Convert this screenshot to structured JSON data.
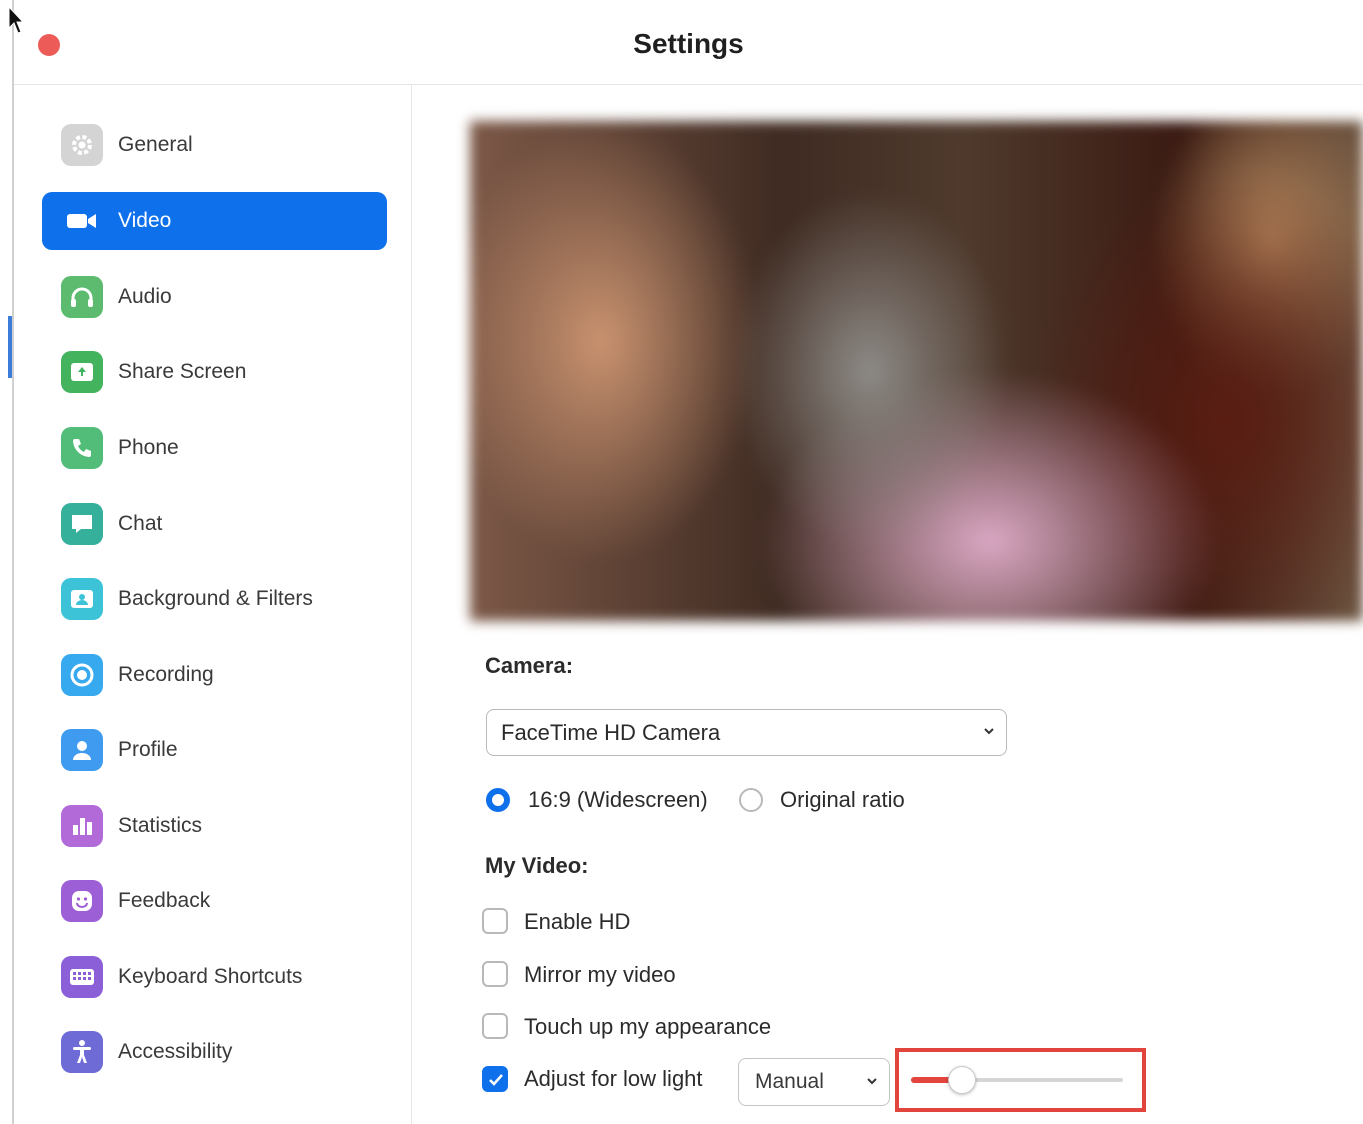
{
  "window": {
    "title": "Settings"
  },
  "sidebar": {
    "items": [
      {
        "label": "General",
        "icon": "gear-icon",
        "color": "#cfcfcf",
        "active": false
      },
      {
        "label": "Video",
        "icon": "video-camera-icon",
        "color": "#0e71eb",
        "active": true
      },
      {
        "label": "Audio",
        "icon": "headphones-icon",
        "color": "#5dbb6f",
        "active": false
      },
      {
        "label": "Share Screen",
        "icon": "share-screen-icon",
        "color": "#43b35e",
        "active": false
      },
      {
        "label": "Phone",
        "icon": "phone-icon",
        "color": "#52bd79",
        "active": false
      },
      {
        "label": "Chat",
        "icon": "chat-bubble-icon",
        "color": "#35b09b",
        "active": false
      },
      {
        "label": "Background & Filters",
        "icon": "background-icon",
        "color": "#3cc3d8",
        "active": false
      },
      {
        "label": "Recording",
        "icon": "record-icon",
        "color": "#36a9ef",
        "active": false
      },
      {
        "label": "Profile",
        "icon": "profile-icon",
        "color": "#3f9bf0",
        "active": false
      },
      {
        "label": "Statistics",
        "icon": "statistics-icon",
        "color": "#b26ad9",
        "active": false
      },
      {
        "label": "Feedback",
        "icon": "feedback-icon",
        "color": "#9d5fd6",
        "active": false
      },
      {
        "label": "Keyboard Shortcuts",
        "icon": "keyboard-icon",
        "color": "#8a5fd8",
        "active": false
      },
      {
        "label": "Accessibility",
        "icon": "accessibility-icon",
        "color": "#6e6bd6",
        "active": false
      }
    ]
  },
  "camera": {
    "label": "Camera:",
    "selected": "FaceTime HD Camera",
    "ratio_options": [
      {
        "label": "16:9 (Widescreen)",
        "selected": true
      },
      {
        "label": "Original ratio",
        "selected": false
      }
    ]
  },
  "my_video": {
    "label": "My Video:",
    "options": [
      {
        "label": "Enable HD",
        "checked": false
      },
      {
        "label": "Mirror my video",
        "checked": false
      },
      {
        "label": "Touch up my appearance",
        "checked": false
      },
      {
        "label": "Adjust for low light",
        "checked": true
      }
    ],
    "low_light_mode": "Manual",
    "low_light_level": 0.24
  },
  "colors": {
    "accent": "#0e71eb",
    "highlight": "#e2453e",
    "close": "#ec5b57"
  }
}
